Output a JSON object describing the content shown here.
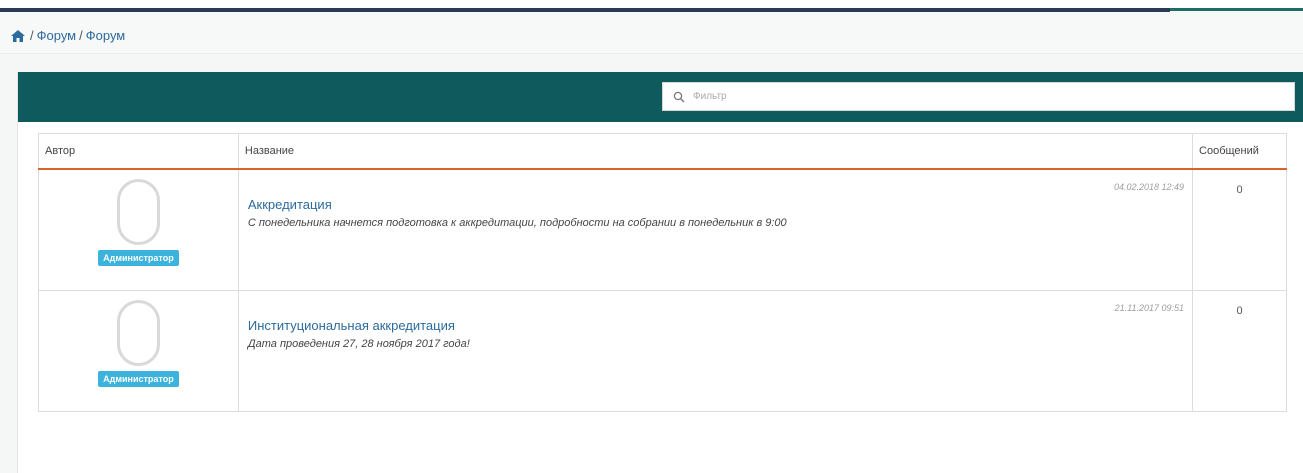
{
  "breadcrumb": {
    "home_icon": "home-icon",
    "items": [
      "Форум",
      "Форум"
    ],
    "separator": "/"
  },
  "filter": {
    "placeholder": "Фильтр",
    "icon": "search-icon"
  },
  "table": {
    "headers": {
      "author": "Автор",
      "title": "Название",
      "messages": "Сообщений"
    },
    "rows": [
      {
        "role": "Администратор",
        "date": "04.02.2018 12:49",
        "title": "Аккредитация",
        "description": "С понедельника начнется подготовка к аккредитации, подробности на собрании в понедельник в 9:00",
        "messages": "0"
      },
      {
        "role": "Администратор",
        "date": "21.11.2017 09:51",
        "title": "Институциональная аккредитация",
        "description": "Дата проведения 27, 28 ноября 2017 года!",
        "messages": "0"
      }
    ]
  },
  "colors": {
    "header_bg": "#0e5a5d",
    "link": "#2c6b9e",
    "badge": "#3bb3dc",
    "accent_line": "#d9632d"
  }
}
